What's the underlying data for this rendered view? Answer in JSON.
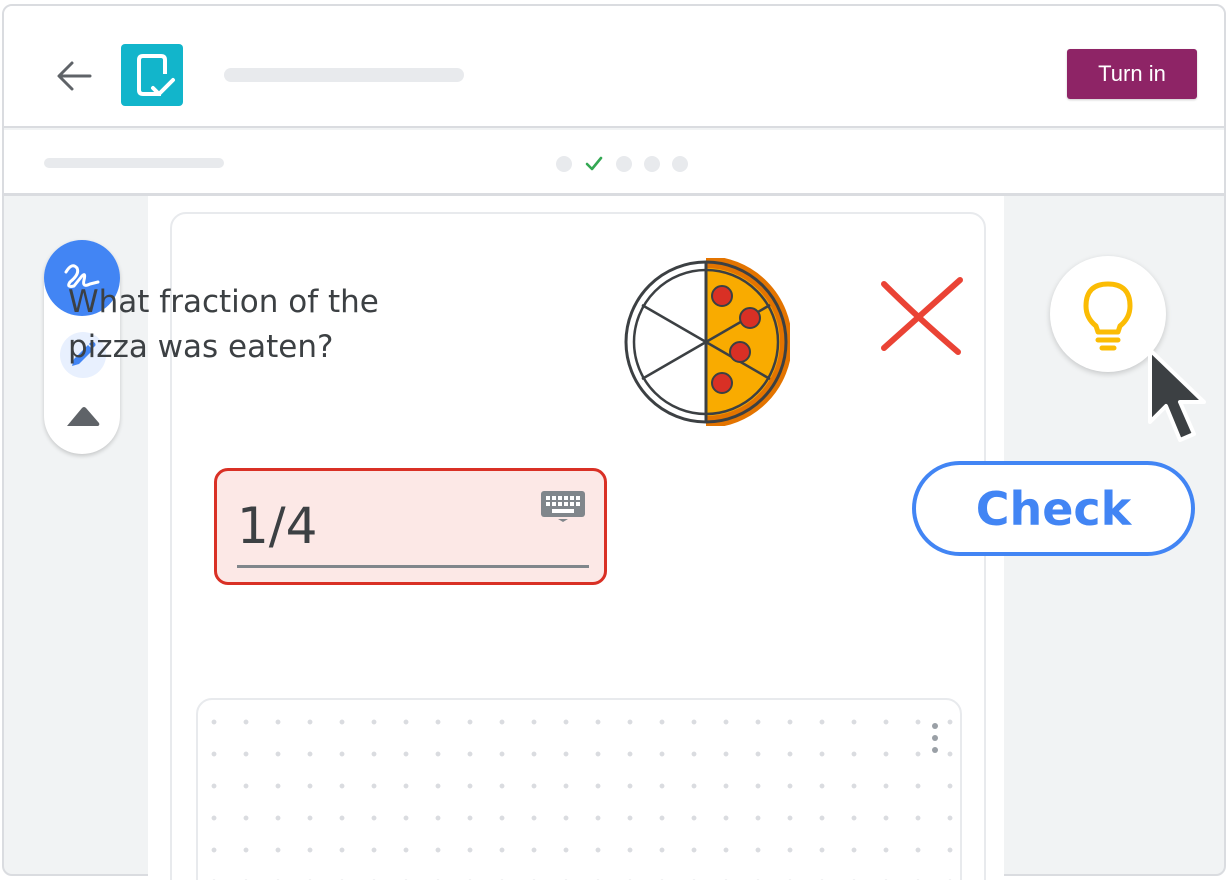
{
  "header": {
    "back_icon": "arrow-back-icon",
    "app_icon": "assignment-check-icon",
    "turn_in_label": "Turn in",
    "turn_in_color": "#8e2466"
  },
  "progress": {
    "step_states": [
      "pending",
      "completed",
      "pending",
      "pending",
      "pending"
    ],
    "current_step": 2,
    "total_steps": 5
  },
  "toolbox": {
    "tools": [
      {
        "icon": "scribble-icon",
        "active": true
      },
      {
        "icon": "pen-icon",
        "active": false
      },
      {
        "icon": "eraser-icon",
        "active": false
      }
    ]
  },
  "question": {
    "text": "What fraction of the pizza was eaten?",
    "image": "pizza-half-eaten-icon"
  },
  "answer": {
    "value": "1/4",
    "status": "incorrect",
    "status_icon": "red-x-icon",
    "error_color": "#d93025",
    "keyboard_icon": "keyboard-icon"
  },
  "actions": {
    "hint_icon": "lightbulb-icon",
    "check_label": "Check",
    "accent_color": "#4285f4"
  },
  "scratchpad": {
    "menu_icon": "more-vert-icon"
  }
}
